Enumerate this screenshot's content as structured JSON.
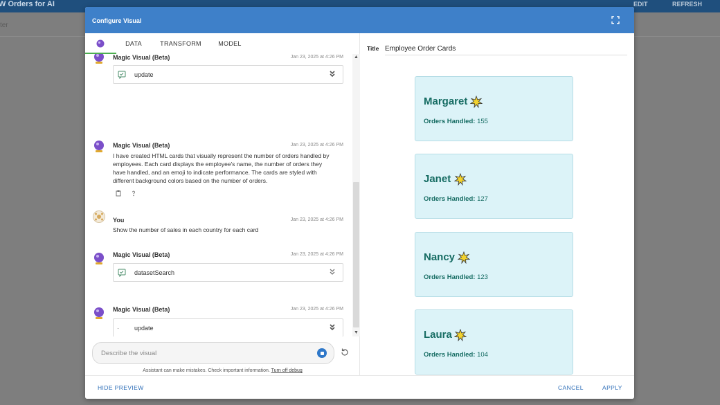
{
  "background_app": {
    "title": "W Orders for AI",
    "actions": [
      "EDIT",
      "REFRESH"
    ],
    "filter_placeholder": "ter"
  },
  "modal": {
    "title": "Configure Visual",
    "tabs": [
      {
        "label": "",
        "icon": "magic-orb-icon"
      },
      {
        "label": "DATA"
      },
      {
        "label": "TRANSFORM"
      },
      {
        "label": "MODEL"
      }
    ]
  },
  "chat": {
    "messages": [
      {
        "author": "Magic Visual (Beta)",
        "time": "Jan 23, 2025 at 4:26 PM",
        "tool": "update"
      },
      {
        "author": "Magic Visual (Beta)",
        "time": "Jan 23, 2025 at 4:26 PM",
        "text": "I have created HTML cards that visually represent the number of orders handled by employees. Each card displays the employee's name, the number of orders they have handled, and an emoji to indicate performance. The cards are styled with different background colors based on the number of orders."
      },
      {
        "author": "You",
        "time": "Jan 23, 2025 at 4:26 PM",
        "text": "Show the number of sales in each country for each card"
      },
      {
        "author": "Magic Visual (Beta)",
        "time": "Jan 23, 2025 at 4:26 PM",
        "tool": "datasetSearch"
      },
      {
        "author": "Magic Visual (Beta)",
        "time": "Jan 23, 2025 at 4:26 PM",
        "tool": "update"
      }
    ],
    "input_placeholder": "Describe the visual",
    "disclaimer": "Assistant can make mistakes. Check important information.",
    "disclaimer_link": "Turn off debug"
  },
  "preview": {
    "title_label": "Title",
    "title_value": "Employee Order Cards",
    "stat_label": "Orders Handled:",
    "cards": [
      {
        "name": "Margaret",
        "orders": "155"
      },
      {
        "name": "Janet",
        "orders": "127"
      },
      {
        "name": "Nancy",
        "orders": "123"
      },
      {
        "name": "Laura",
        "orders": "104"
      }
    ]
  },
  "footer": {
    "hide_preview": "HIDE PREVIEW",
    "cancel": "CANCEL",
    "apply": "APPLY"
  },
  "colors": {
    "header": "#3e80c9",
    "accent_tab": "#4caf50",
    "card_bg": "#dcf3f8",
    "card_text": "#166c63",
    "link": "#2f6fb8"
  }
}
